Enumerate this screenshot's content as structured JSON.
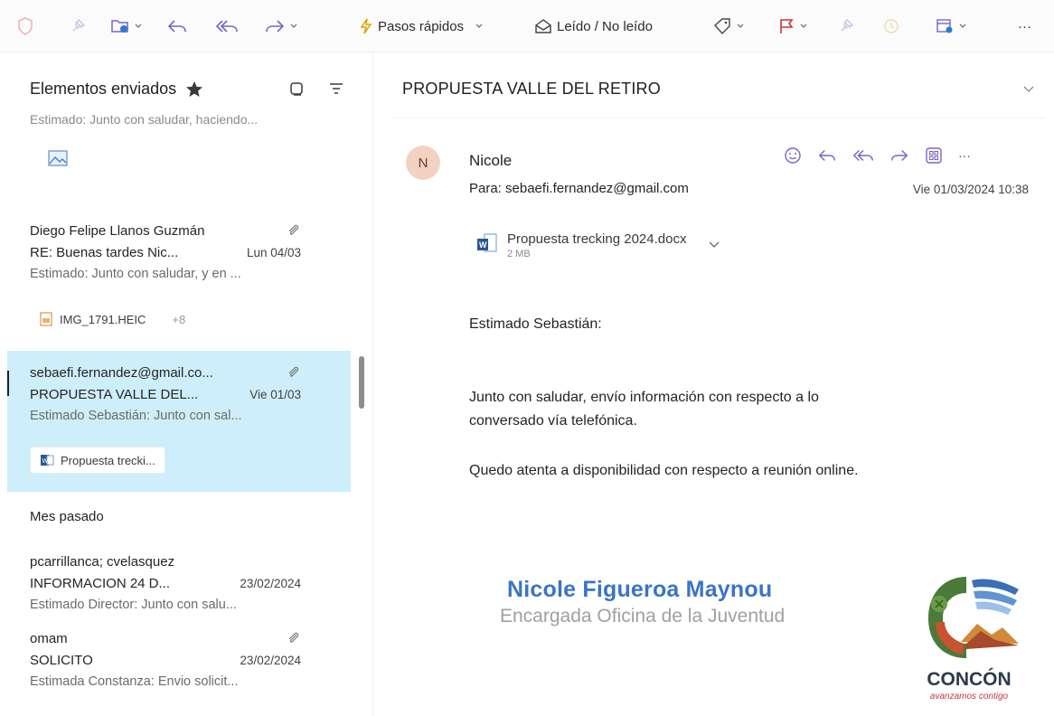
{
  "toolbar": {
    "quick_steps_label": "Pasos rápidos",
    "read_unread_label": "Leído / No leído",
    "more_label": "···"
  },
  "list": {
    "folder_title": "Elementos enviados",
    "cut_preview": "Estimado: Junto con saludar, haciendo...",
    "messages": [
      {
        "from": "Diego Felipe Llanos Guzmán",
        "subject": "RE: Buenas tardes Nic...",
        "date": "Lun 04/03",
        "preview": "Estimado: Junto con saludar, y en ...",
        "attachment": "IMG_1791.HEIC",
        "extra": "+8"
      },
      {
        "from": "sebaefi.fernandez@gmail.co...",
        "subject": "PROPUESTA VALLE DEL...",
        "date": "Vie 01/03",
        "preview": "Estimado Sebastián: Junto con sal...",
        "attachment": "Propuesta trecki..."
      }
    ],
    "section_label": "Mes pasado",
    "older": [
      {
        "from": "pcarrillanca; cvelasquez",
        "subject": "INFORMACION 24 D...",
        "date": "23/02/2024",
        "preview": "Estimado Director: Junto con salu..."
      },
      {
        "from": "omam",
        "subject": "SOLICITO",
        "date": "23/02/2024",
        "preview": "Estimada Constanza: Envio solicit..."
      }
    ]
  },
  "reading": {
    "subject": "PROPUESTA VALLE DEL RETIRO",
    "avatar_initial": "N",
    "sender": "Nicole",
    "to_label": "Para:",
    "to_address": "sebaefi.fernandez@gmail.com",
    "date": "Vie 01/03/2024 10:38",
    "more_label": "···",
    "attachment": {
      "name": "Propuesta trecking 2024.docx",
      "size": "2 MB"
    },
    "greeting": "Estimado Sebastián:",
    "paragraph1_line1": "Junto con saludar, envío información con respecto a lo",
    "paragraph1_line2": "conversado vía telefónica.",
    "paragraph2": "Quedo atenta a disponibilidad con respecto a reunión online.",
    "signature_name": "Nicole Figueroa Maynou",
    "signature_role": "Encargada Oficina de la Juventud",
    "logo_text": "CONCÓN",
    "logo_tagline": "avanzamos contigo"
  },
  "colors": {
    "accent_purple": "#7b63c6",
    "flag_red": "#d13438",
    "selection": "#cdeefa",
    "signature_blue": "#3a74c8",
    "word_blue": "#2b5797"
  }
}
